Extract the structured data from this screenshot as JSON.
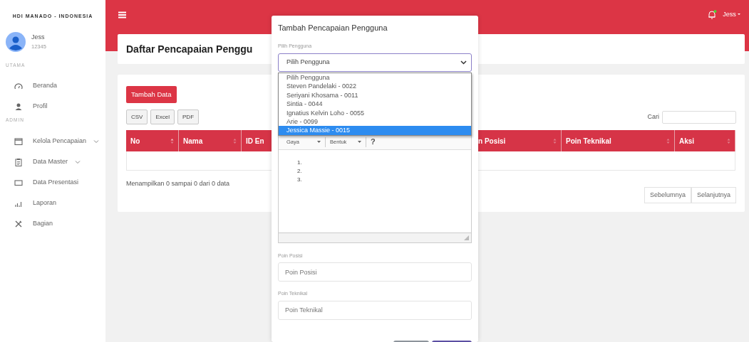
{
  "sidebar": {
    "brand": "HDI MANADO - INDONESIA",
    "user": {
      "name": "Jess",
      "id": "12345"
    },
    "sections": [
      {
        "title": "UTAMA",
        "items": [
          {
            "kind": "gauge",
            "label": "Beranda",
            "expandable": false
          },
          {
            "kind": "user",
            "label": "Profil",
            "expandable": false
          }
        ]
      },
      {
        "title": "ADMIN",
        "items": [
          {
            "kind": "window",
            "label": "Kelola Pencapaian",
            "expandable": true
          },
          {
            "kind": "clipboard",
            "label": "Data Master",
            "expandable": true
          },
          {
            "kind": "monitor",
            "label": "Data Presentasi",
            "expandable": false
          },
          {
            "kind": "chart",
            "label": "Laporan",
            "expandable": false
          },
          {
            "kind": "tools",
            "label": "Bagian",
            "expandable": false
          }
        ]
      }
    ]
  },
  "topbar": {
    "notification": true,
    "user": "Jess"
  },
  "page_title": "Daftar Pencapaian Penggu",
  "panel": {
    "add_button": "Tambah Data",
    "export_buttons": [
      "CSV",
      "Excel",
      "PDF"
    ],
    "search_label": "Cari",
    "columns": [
      {
        "label": "No",
        "sorted": true
      },
      {
        "label": "Nama",
        "sorted": false
      },
      {
        "label": "ID En"
      },
      {
        "label": "n Posisi",
        "sorted": false
      },
      {
        "label": "Poin Teknikal",
        "sorted": false
      },
      {
        "label": "Aksi",
        "sorted": false
      }
    ],
    "info": "Menampilkan 0 sampai 0 dari 0 data",
    "pagination": [
      "Sebelumnya",
      "Selanjutnya"
    ]
  },
  "modal": {
    "title": "Tambah Pencapaian Pengguna",
    "select_label": "Pilih Pengguna",
    "select_value": "Pilih Pengguna",
    "options": [
      {
        "label": "Pilih Pengguna",
        "selected": false
      },
      {
        "label": "Steven Pandelaki - 0022",
        "selected": false
      },
      {
        "label": "Seriyani Khosama - 0011",
        "selected": false
      },
      {
        "label": "Sintia - 0044",
        "selected": false
      },
      {
        "label": "Ignatius Kelvin Loho - 0055",
        "selected": false
      },
      {
        "label": "Arie - 0099",
        "selected": false
      },
      {
        "label": "Jessica Massie - 0015",
        "selected": true
      }
    ],
    "editor_toolbar": [
      "Gaya",
      "Bentuk",
      "?"
    ],
    "editor_list": [
      "1.",
      "2.",
      "3."
    ],
    "fields": [
      {
        "label": "Poin Posisi",
        "placeholder": "Poin Posisi"
      },
      {
        "label": "Poin Teknikal",
        "placeholder": "Poin Teknikal"
      }
    ],
    "footer_buttons": [
      {
        "kind": "secondary"
      },
      {
        "kind": "primary"
      }
    ]
  }
}
